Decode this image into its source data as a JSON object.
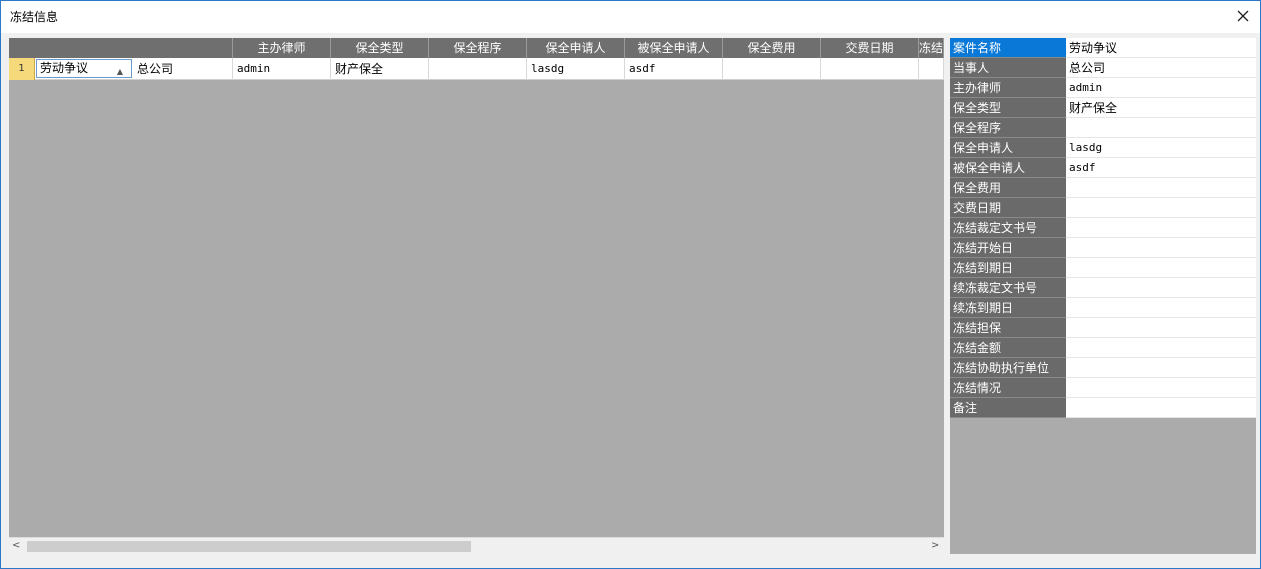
{
  "window": {
    "title": "冻结信息",
    "close_label": "✕"
  },
  "grid": {
    "columns": [
      "",
      "主办律师",
      "保全类型",
      "保全程序",
      "保全申请人",
      "被保全申请人",
      "保全费用",
      "交费日期",
      "冻结"
    ],
    "row": {
      "row_number": "1",
      "case_name": "劳动争议",
      "party": "总公司",
      "lawyer": "admin",
      "preservation_type": "财产保全",
      "procedure": "",
      "applicant": "lasdg",
      "respondent": "asdf",
      "fee": "",
      "pay_date": "",
      "freeze": ""
    },
    "scroll_left": "<",
    "scroll_right": ">"
  },
  "props": {
    "rows": [
      {
        "key": "案件名称",
        "value": "劳动争议"
      },
      {
        "key": "当事人",
        "value": "总公司"
      },
      {
        "key": "主办律师",
        "value": "admin"
      },
      {
        "key": "保全类型",
        "value": "财产保全"
      },
      {
        "key": "保全程序",
        "value": ""
      },
      {
        "key": "保全申请人",
        "value": "lasdg"
      },
      {
        "key": "被保全申请人",
        "value": "asdf"
      },
      {
        "key": "保全费用",
        "value": ""
      },
      {
        "key": "交费日期",
        "value": ""
      },
      {
        "key": "冻结裁定文书号",
        "value": ""
      },
      {
        "key": "冻结开始日",
        "value": ""
      },
      {
        "key": "冻结到期日",
        "value": ""
      },
      {
        "key": "续冻裁定文书号",
        "value": ""
      },
      {
        "key": "续冻到期日",
        "value": ""
      },
      {
        "key": "冻结担保",
        "value": ""
      },
      {
        "key": "冻结金额",
        "value": ""
      },
      {
        "key": "冻结协助执行单位",
        "value": ""
      },
      {
        "key": "冻结情况",
        "value": ""
      },
      {
        "key": "备注",
        "value": ""
      }
    ]
  },
  "colors": {
    "header_bg": "#6f6f6f",
    "selected_key": "#0a78d7",
    "empty_area": "#ababab",
    "row_marker": "#f6d97a"
  }
}
